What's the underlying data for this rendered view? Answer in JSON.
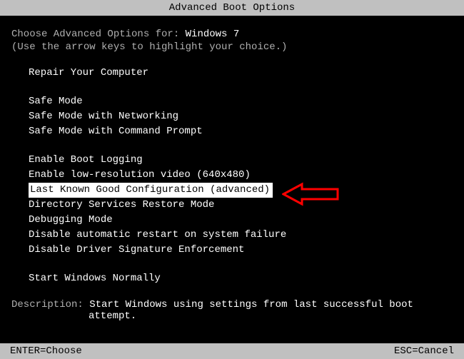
{
  "title": "Advanced Boot Options",
  "prompt_prefix": "Choose Advanced Options for: ",
  "prompt_os": "Windows 7",
  "hint": "(Use the arrow keys to highlight your choice.)",
  "menu": {
    "groups": [
      [
        "Repair Your Computer"
      ],
      [
        "Safe Mode",
        "Safe Mode with Networking",
        "Safe Mode with Command Prompt"
      ],
      [
        "Enable Boot Logging",
        "Enable low-resolution video (640x480)",
        "Last Known Good Configuration (advanced)",
        "Directory Services Restore Mode",
        "Debugging Mode",
        "Disable automatic restart on system failure",
        "Disable Driver Signature Enforcement"
      ],
      [
        "Start Windows Normally"
      ]
    ],
    "selected": "Last Known Good Configuration (advanced)"
  },
  "description": {
    "label": "Description: ",
    "line1": "Start Windows using settings from last successful boot",
    "line2": "attempt."
  },
  "footer": {
    "left": "ENTER=Choose",
    "right": "ESC=Cancel"
  },
  "annotation": {
    "arrow_color": "#ff0000"
  }
}
